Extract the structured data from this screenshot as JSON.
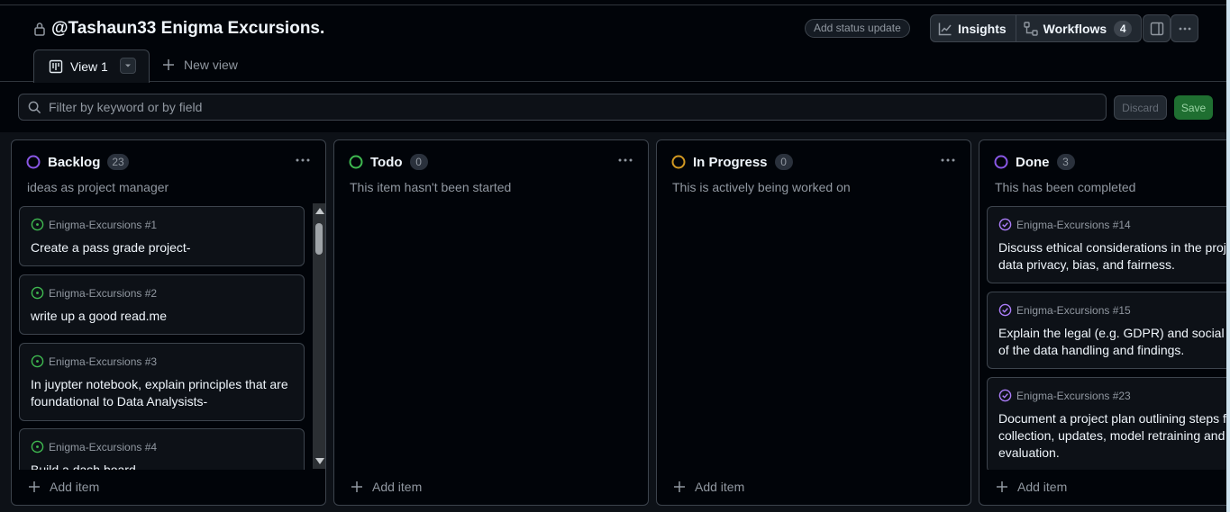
{
  "project": {
    "title": "@Tashaun33 Enigma Excursions.",
    "lock_icon": "lock-icon"
  },
  "header": {
    "status_update_label": "Add status update",
    "insights_label": "Insights",
    "workflows_label": "Workflows",
    "workflows_count": "4"
  },
  "views": {
    "active_tab_label": "View 1",
    "new_view_label": "New view"
  },
  "filter": {
    "placeholder": "Filter by keyword or by field",
    "discard_label": "Discard",
    "save_label": "Save"
  },
  "columns": [
    {
      "title": "Backlog",
      "count": "23",
      "description": "ideas as project manager",
      "status_color": "#8957e5",
      "add_item_label": "Add item",
      "cards": [
        {
          "ref": "Enigma-Excursions #1",
          "text": "Create a pass grade project-"
        },
        {
          "ref": "Enigma-Excursions #2",
          "text": "write up a good read.me"
        },
        {
          "ref": "Enigma-Excursions #3",
          "text": "In juypter notebook, explain principles that are foundational to Data Analysists-"
        },
        {
          "ref": "Enigma-Excursions #4",
          "text": "Build a dash board"
        }
      ]
    },
    {
      "title": "Todo",
      "count": "0",
      "description": "This item hasn't been started",
      "status_color": "#3fb950",
      "add_item_label": "Add item",
      "cards": []
    },
    {
      "title": "In Progress",
      "count": "0",
      "description": "This is actively being worked on",
      "status_color": "#d29922",
      "add_item_label": "Add item",
      "cards": []
    },
    {
      "title": "Done",
      "count": "3",
      "description": "This has been completed",
      "status_color": "#8957e5",
      "add_item_label": "Add item",
      "cards": [
        {
          "ref": "Enigma-Excursions #14",
          "text": "Discuss ethical considerations in the project, such as data privacy, bias, and fairness."
        },
        {
          "ref": "Enigma-Excursions #15",
          "text": "Explain the legal (e.g. GDPR) and social implications of the data handling and findings."
        },
        {
          "ref": "Enigma-Excursions #23",
          "text": "Document a project plan outlining steps for data collection, updates, model retraining and ongoing evaluation."
        }
      ]
    }
  ]
}
